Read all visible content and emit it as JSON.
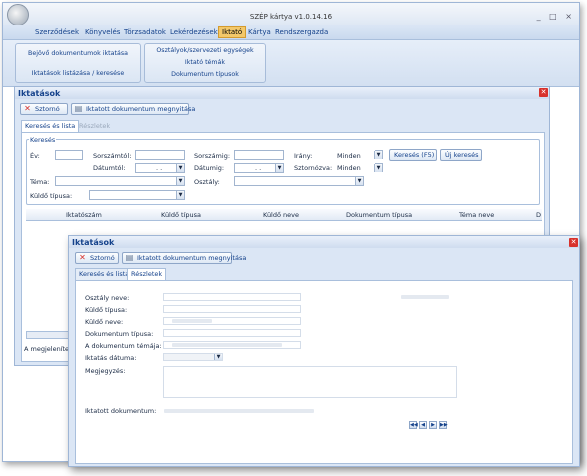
{
  "window": {
    "title": "SZÉP kártya    v1.0.14.16",
    "controls": "_ □ ×"
  },
  "menu": [
    "Szerződések",
    "Könyvelés",
    "Törzsadatok",
    "Lekérdezések",
    "Iktató",
    "Kártya",
    "Rendszergazda"
  ],
  "menu_active": "Iktató",
  "ribbon": {
    "group1": [
      "Bejövő dokumentumok iktatása",
      "Iktatások listázása / keresése"
    ],
    "group2": [
      "Osztályok/szervezeti egységek",
      "Iktató témák",
      "Dokumentum típusok"
    ]
  },
  "iktatasok": {
    "title": "Iktatások",
    "storno": "Sztornó",
    "open_doc": "Iktatott dokumentum megnyitása",
    "tabs": [
      "Keresés és lista",
      "Részletek"
    ],
    "search": {
      "legend": "Keresés",
      "ev": "Év:",
      "sorszamtol": "Sorszámtól:",
      "sorszamig": "Sorszámig:",
      "irany": "Irány:",
      "irany_value": "Minden",
      "datumtol": "Dátumtól:",
      "datumig": "Dátumig:",
      "sztornozva": "Sztornózva:",
      "sztornozva_value": "Minden",
      "tema": "Téma:",
      "osztaly": "Osztály:",
      "kuldo_tipusa": "Küldő típusa:",
      "search_btn": "Keresés (F5)",
      "new_search_btn": "Új keresés",
      "date_placeholder": ". ."
    },
    "grid_columns": [
      "Iktatószám",
      "Küldő típusa",
      "Küldő neve",
      "Dokumentum típusa",
      "Téma neve",
      "D"
    ],
    "status": "A megjelenítet"
  },
  "details": {
    "title": "Iktatások",
    "storno": "Sztornó",
    "open_doc": "Iktatott dokumentum megnyitása",
    "tabs": [
      "Keresés és lista",
      "Részletek"
    ],
    "fields": [
      "Osztály neve:",
      "Küldő típusa:",
      "Küldő neve:",
      "Dokumentum típusa:",
      "A dokumentum témája:",
      "Iktatás dátuma:",
      "Megjegyzés:",
      "Iktatott dokumentum:"
    ]
  },
  "icons": {
    "storno": "red-x-icon",
    "open_doc": "document-icon",
    "close": "close-icon"
  }
}
